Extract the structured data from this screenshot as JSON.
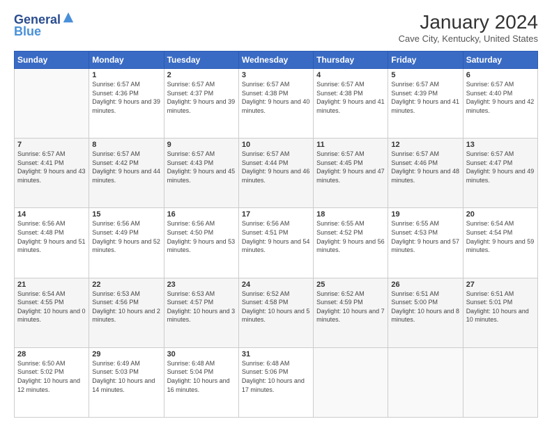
{
  "header": {
    "logo_general": "General",
    "logo_blue": "Blue",
    "title": "January 2024",
    "location": "Cave City, Kentucky, United States"
  },
  "weekdays": [
    "Sunday",
    "Monday",
    "Tuesday",
    "Wednesday",
    "Thursday",
    "Friday",
    "Saturday"
  ],
  "weeks": [
    [
      {
        "day": "",
        "sunrise": "",
        "sunset": "",
        "daylight": ""
      },
      {
        "day": "1",
        "sunrise": "Sunrise: 6:57 AM",
        "sunset": "Sunset: 4:36 PM",
        "daylight": "Daylight: 9 hours and 39 minutes."
      },
      {
        "day": "2",
        "sunrise": "Sunrise: 6:57 AM",
        "sunset": "Sunset: 4:37 PM",
        "daylight": "Daylight: 9 hours and 39 minutes."
      },
      {
        "day": "3",
        "sunrise": "Sunrise: 6:57 AM",
        "sunset": "Sunset: 4:38 PM",
        "daylight": "Daylight: 9 hours and 40 minutes."
      },
      {
        "day": "4",
        "sunrise": "Sunrise: 6:57 AM",
        "sunset": "Sunset: 4:38 PM",
        "daylight": "Daylight: 9 hours and 41 minutes."
      },
      {
        "day": "5",
        "sunrise": "Sunrise: 6:57 AM",
        "sunset": "Sunset: 4:39 PM",
        "daylight": "Daylight: 9 hours and 41 minutes."
      },
      {
        "day": "6",
        "sunrise": "Sunrise: 6:57 AM",
        "sunset": "Sunset: 4:40 PM",
        "daylight": "Daylight: 9 hours and 42 minutes."
      }
    ],
    [
      {
        "day": "7",
        "sunrise": "Sunrise: 6:57 AM",
        "sunset": "Sunset: 4:41 PM",
        "daylight": "Daylight: 9 hours and 43 minutes."
      },
      {
        "day": "8",
        "sunrise": "Sunrise: 6:57 AM",
        "sunset": "Sunset: 4:42 PM",
        "daylight": "Daylight: 9 hours and 44 minutes."
      },
      {
        "day": "9",
        "sunrise": "Sunrise: 6:57 AM",
        "sunset": "Sunset: 4:43 PM",
        "daylight": "Daylight: 9 hours and 45 minutes."
      },
      {
        "day": "10",
        "sunrise": "Sunrise: 6:57 AM",
        "sunset": "Sunset: 4:44 PM",
        "daylight": "Daylight: 9 hours and 46 minutes."
      },
      {
        "day": "11",
        "sunrise": "Sunrise: 6:57 AM",
        "sunset": "Sunset: 4:45 PM",
        "daylight": "Daylight: 9 hours and 47 minutes."
      },
      {
        "day": "12",
        "sunrise": "Sunrise: 6:57 AM",
        "sunset": "Sunset: 4:46 PM",
        "daylight": "Daylight: 9 hours and 48 minutes."
      },
      {
        "day": "13",
        "sunrise": "Sunrise: 6:57 AM",
        "sunset": "Sunset: 4:47 PM",
        "daylight": "Daylight: 9 hours and 49 minutes."
      }
    ],
    [
      {
        "day": "14",
        "sunrise": "Sunrise: 6:56 AM",
        "sunset": "Sunset: 4:48 PM",
        "daylight": "Daylight: 9 hours and 51 minutes."
      },
      {
        "day": "15",
        "sunrise": "Sunrise: 6:56 AM",
        "sunset": "Sunset: 4:49 PM",
        "daylight": "Daylight: 9 hours and 52 minutes."
      },
      {
        "day": "16",
        "sunrise": "Sunrise: 6:56 AM",
        "sunset": "Sunset: 4:50 PM",
        "daylight": "Daylight: 9 hours and 53 minutes."
      },
      {
        "day": "17",
        "sunrise": "Sunrise: 6:56 AM",
        "sunset": "Sunset: 4:51 PM",
        "daylight": "Daylight: 9 hours and 54 minutes."
      },
      {
        "day": "18",
        "sunrise": "Sunrise: 6:55 AM",
        "sunset": "Sunset: 4:52 PM",
        "daylight": "Daylight: 9 hours and 56 minutes."
      },
      {
        "day": "19",
        "sunrise": "Sunrise: 6:55 AM",
        "sunset": "Sunset: 4:53 PM",
        "daylight": "Daylight: 9 hours and 57 minutes."
      },
      {
        "day": "20",
        "sunrise": "Sunrise: 6:54 AM",
        "sunset": "Sunset: 4:54 PM",
        "daylight": "Daylight: 9 hours and 59 minutes."
      }
    ],
    [
      {
        "day": "21",
        "sunrise": "Sunrise: 6:54 AM",
        "sunset": "Sunset: 4:55 PM",
        "daylight": "Daylight: 10 hours and 0 minutes."
      },
      {
        "day": "22",
        "sunrise": "Sunrise: 6:53 AM",
        "sunset": "Sunset: 4:56 PM",
        "daylight": "Daylight: 10 hours and 2 minutes."
      },
      {
        "day": "23",
        "sunrise": "Sunrise: 6:53 AM",
        "sunset": "Sunset: 4:57 PM",
        "daylight": "Daylight: 10 hours and 3 minutes."
      },
      {
        "day": "24",
        "sunrise": "Sunrise: 6:52 AM",
        "sunset": "Sunset: 4:58 PM",
        "daylight": "Daylight: 10 hours and 5 minutes."
      },
      {
        "day": "25",
        "sunrise": "Sunrise: 6:52 AM",
        "sunset": "Sunset: 4:59 PM",
        "daylight": "Daylight: 10 hours and 7 minutes."
      },
      {
        "day": "26",
        "sunrise": "Sunrise: 6:51 AM",
        "sunset": "Sunset: 5:00 PM",
        "daylight": "Daylight: 10 hours and 8 minutes."
      },
      {
        "day": "27",
        "sunrise": "Sunrise: 6:51 AM",
        "sunset": "Sunset: 5:01 PM",
        "daylight": "Daylight: 10 hours and 10 minutes."
      }
    ],
    [
      {
        "day": "28",
        "sunrise": "Sunrise: 6:50 AM",
        "sunset": "Sunset: 5:02 PM",
        "daylight": "Daylight: 10 hours and 12 minutes."
      },
      {
        "day": "29",
        "sunrise": "Sunrise: 6:49 AM",
        "sunset": "Sunset: 5:03 PM",
        "daylight": "Daylight: 10 hours and 14 minutes."
      },
      {
        "day": "30",
        "sunrise": "Sunrise: 6:48 AM",
        "sunset": "Sunset: 5:04 PM",
        "daylight": "Daylight: 10 hours and 16 minutes."
      },
      {
        "day": "31",
        "sunrise": "Sunrise: 6:48 AM",
        "sunset": "Sunset: 5:06 PM",
        "daylight": "Daylight: 10 hours and 17 minutes."
      },
      {
        "day": "",
        "sunrise": "",
        "sunset": "",
        "daylight": ""
      },
      {
        "day": "",
        "sunrise": "",
        "sunset": "",
        "daylight": ""
      },
      {
        "day": "",
        "sunrise": "",
        "sunset": "",
        "daylight": ""
      }
    ]
  ]
}
